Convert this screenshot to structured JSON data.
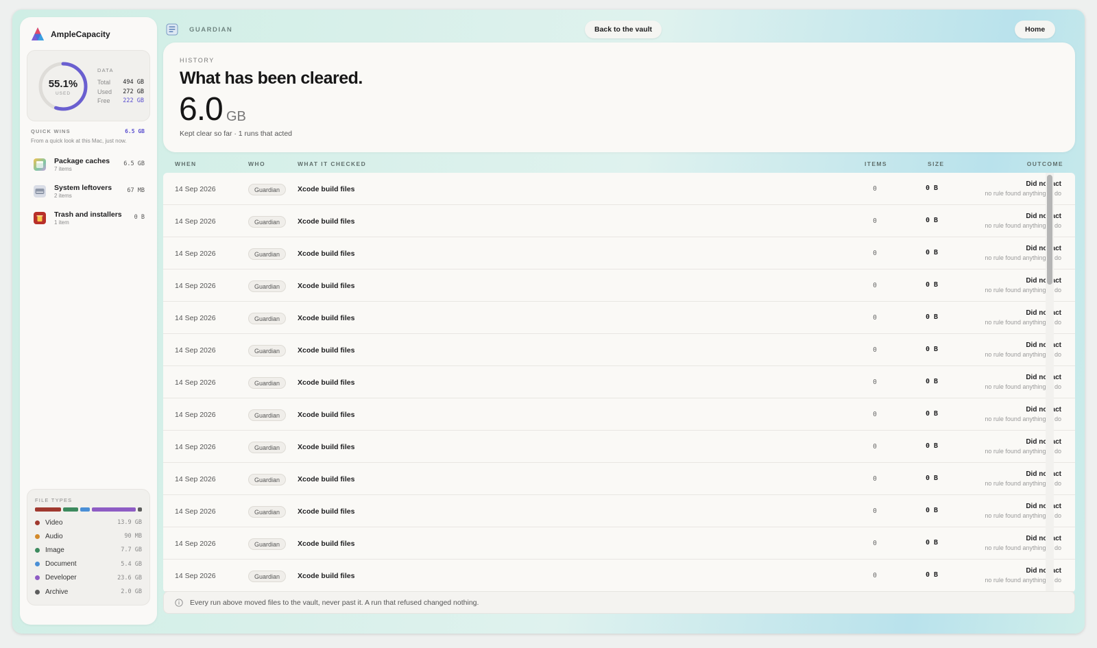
{
  "app": {
    "name": "AmpleCapacity"
  },
  "storage": {
    "percent_used": "55.1%",
    "used_caption": "USED",
    "section_label": "DATA",
    "rows": [
      {
        "label": "Total",
        "value": "494 GB"
      },
      {
        "label": "Used",
        "value": "272 GB"
      },
      {
        "label": "Free",
        "value": "222 GB"
      }
    ],
    "used_fraction": 0.551
  },
  "quick_wins": {
    "title": "QUICK WINS",
    "total": "6.5 GB",
    "subtitle": "From a quick look at this Mac, just now.",
    "items": [
      {
        "name": "Package caches",
        "count": "7 items",
        "size": "6.5 GB",
        "icon": "package-icon"
      },
      {
        "name": "System leftovers",
        "count": "2 items",
        "size": "67 MB",
        "icon": "drive-icon"
      },
      {
        "name": "Trash and installers",
        "count": "1 item",
        "size": "0 B",
        "icon": "trash-icon"
      }
    ]
  },
  "file_types": {
    "title": "FILE TYPES",
    "items": [
      {
        "name": "Video",
        "size": "13.9 GB",
        "color": "#a0392f"
      },
      {
        "name": "Audio",
        "size": "90 MB",
        "color": "#d38a2b"
      },
      {
        "name": "Image",
        "size": "7.7 GB",
        "color": "#3d8a5e"
      },
      {
        "name": "Document",
        "size": "5.4 GB",
        "color": "#4a8fd6"
      },
      {
        "name": "Developer",
        "size": "23.6 GB",
        "color": "#8e5cc4"
      },
      {
        "name": "Archive",
        "size": "2.0 GB",
        "color": "#5d5d5d"
      }
    ]
  },
  "topbar": {
    "section": "GUARDIAN",
    "back_label": "Back to the vault",
    "home_label": "Home"
  },
  "hero": {
    "label": "HISTORY",
    "title": "What has been cleared.",
    "amount": "6.0",
    "unit": "GB",
    "subtitle": "Kept clear so far · 1 runs that acted"
  },
  "table": {
    "columns": {
      "when": "WHEN",
      "who": "WHO",
      "what": "WHAT IT CHECKED",
      "items": "ITEMS",
      "size": "SIZE",
      "outcome": "OUTCOME"
    },
    "rows": [
      {
        "when": "14 Sep 2026",
        "who": "Guardian",
        "what": "Xcode build files",
        "items": "0",
        "size": "0 B",
        "outcome": "Did not act",
        "reason": "no rule found anything to do"
      },
      {
        "when": "14 Sep 2026",
        "who": "Guardian",
        "what": "Xcode build files",
        "items": "0",
        "size": "0 B",
        "outcome": "Did not act",
        "reason": "no rule found anything to do"
      },
      {
        "when": "14 Sep 2026",
        "who": "Guardian",
        "what": "Xcode build files",
        "items": "0",
        "size": "0 B",
        "outcome": "Did not act",
        "reason": "no rule found anything to do"
      },
      {
        "when": "14 Sep 2026",
        "who": "Guardian",
        "what": "Xcode build files",
        "items": "0",
        "size": "0 B",
        "outcome": "Did not act",
        "reason": "no rule found anything to do"
      },
      {
        "when": "14 Sep 2026",
        "who": "Guardian",
        "what": "Xcode build files",
        "items": "0",
        "size": "0 B",
        "outcome": "Did not act",
        "reason": "no rule found anything to do"
      },
      {
        "when": "14 Sep 2026",
        "who": "Guardian",
        "what": "Xcode build files",
        "items": "0",
        "size": "0 B",
        "outcome": "Did not act",
        "reason": "no rule found anything to do"
      },
      {
        "when": "14 Sep 2026",
        "who": "Guardian",
        "what": "Xcode build files",
        "items": "0",
        "size": "0 B",
        "outcome": "Did not act",
        "reason": "no rule found anything to do"
      },
      {
        "when": "14 Sep 2026",
        "who": "Guardian",
        "what": "Xcode build files",
        "items": "0",
        "size": "0 B",
        "outcome": "Did not act",
        "reason": "no rule found anything to do"
      },
      {
        "when": "14 Sep 2026",
        "who": "Guardian",
        "what": "Xcode build files",
        "items": "0",
        "size": "0 B",
        "outcome": "Did not act",
        "reason": "no rule found anything to do"
      },
      {
        "when": "14 Sep 2026",
        "who": "Guardian",
        "what": "Xcode build files",
        "items": "0",
        "size": "0 B",
        "outcome": "Did not act",
        "reason": "no rule found anything to do"
      },
      {
        "when": "14 Sep 2026",
        "who": "Guardian",
        "what": "Xcode build files",
        "items": "0",
        "size": "0 B",
        "outcome": "Did not act",
        "reason": "no rule found anything to do"
      },
      {
        "when": "14 Sep 2026",
        "who": "Guardian",
        "what": "Xcode build files",
        "items": "0",
        "size": "0 B",
        "outcome": "Did not act",
        "reason": "no rule found anything to do"
      },
      {
        "when": "14 Sep 2026",
        "who": "Guardian",
        "what": "Xcode build files",
        "items": "0",
        "size": "0 B",
        "outcome": "Did not act",
        "reason": "no rule found anything to do"
      }
    ]
  },
  "footer": {
    "note": "Every run above moved files to the vault, never past it. A run that refused changed nothing.",
    "icon": "info-icon"
  }
}
